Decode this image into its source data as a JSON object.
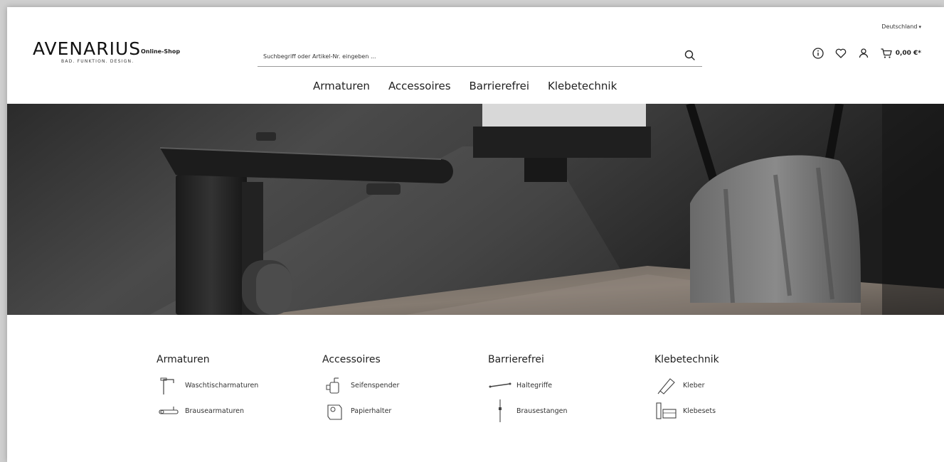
{
  "header": {
    "logo_text": "AVENARIUS",
    "logo_tagline": "BAD. FUNKTION. DESIGN.",
    "shop_label": "Online-Shop",
    "search_placeholder": "Suchbegriff oder Artikel-Nr. eingeben ...",
    "country": "Deutschland",
    "cart_total": "0,00 €*",
    "icons": [
      "info-icon",
      "heart-icon",
      "user-icon",
      "cart-icon"
    ]
  },
  "nav": {
    "items": [
      "Armaturen",
      "Accessoires",
      "Barrierefrei",
      "Klebetechnik"
    ]
  },
  "categories": [
    {
      "title": "Armaturen",
      "items": [
        {
          "label": "Waschtischarmaturen",
          "icon": "faucet-icon"
        },
        {
          "label": "Brausearmaturen",
          "icon": "shower-mixer-icon"
        }
      ]
    },
    {
      "title": "Accessoires",
      "items": [
        {
          "label": "Seifenspender",
          "icon": "soap-dispenser-icon"
        },
        {
          "label": "Papierhalter",
          "icon": "paper-holder-icon"
        }
      ]
    },
    {
      "title": "Barrierefrei",
      "items": [
        {
          "label": "Haltegriffe",
          "icon": "grab-bar-icon"
        },
        {
          "label": "Brausestangen",
          "icon": "shower-rail-icon"
        }
      ]
    },
    {
      "title": "Klebetechnik",
      "items": [
        {
          "label": "Kleber",
          "icon": "glue-tube-icon"
        },
        {
          "label": "Klebesets",
          "icon": "adhesive-set-icon"
        }
      ]
    }
  ],
  "colors": {
    "text": "#222222",
    "hero_bg": "#3a3a3a",
    "page_bg": "#ffffff"
  }
}
